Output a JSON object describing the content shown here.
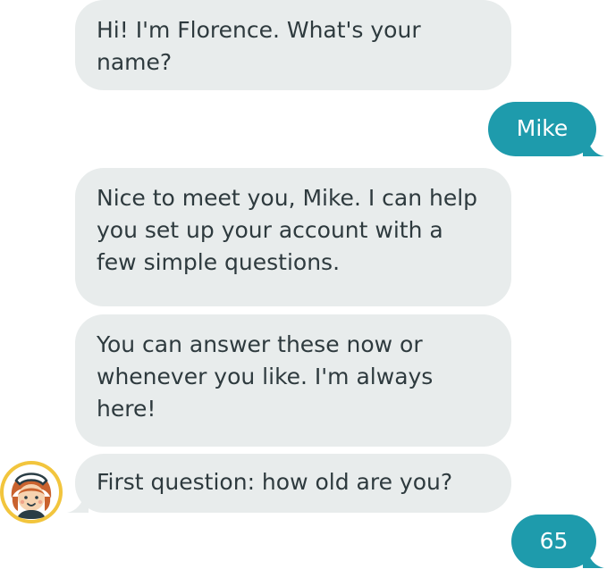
{
  "conversation": {
    "colors": {
      "bot_bubble": "#e8ecec",
      "bot_text": "#2e3a3e",
      "user_bubble": "#1e9bac",
      "user_text": "#ffffff",
      "avatar_ring": "#f2c53d"
    },
    "messages": [
      {
        "sender": "bot",
        "text": "Hi! I'm Florence. What's your name?"
      },
      {
        "sender": "user",
        "text": "Mike"
      },
      {
        "sender": "bot",
        "text": "Nice to meet you, Mike. I can help you set up your account with a few simple questions."
      },
      {
        "sender": "bot",
        "text": "You can answer these now or whenever you like. I'm always here!"
      },
      {
        "sender": "bot",
        "text": "First question: how old are you?"
      },
      {
        "sender": "user",
        "text": "65"
      }
    ],
    "bot_avatar": {
      "icon": "nurse-avatar-icon"
    }
  }
}
